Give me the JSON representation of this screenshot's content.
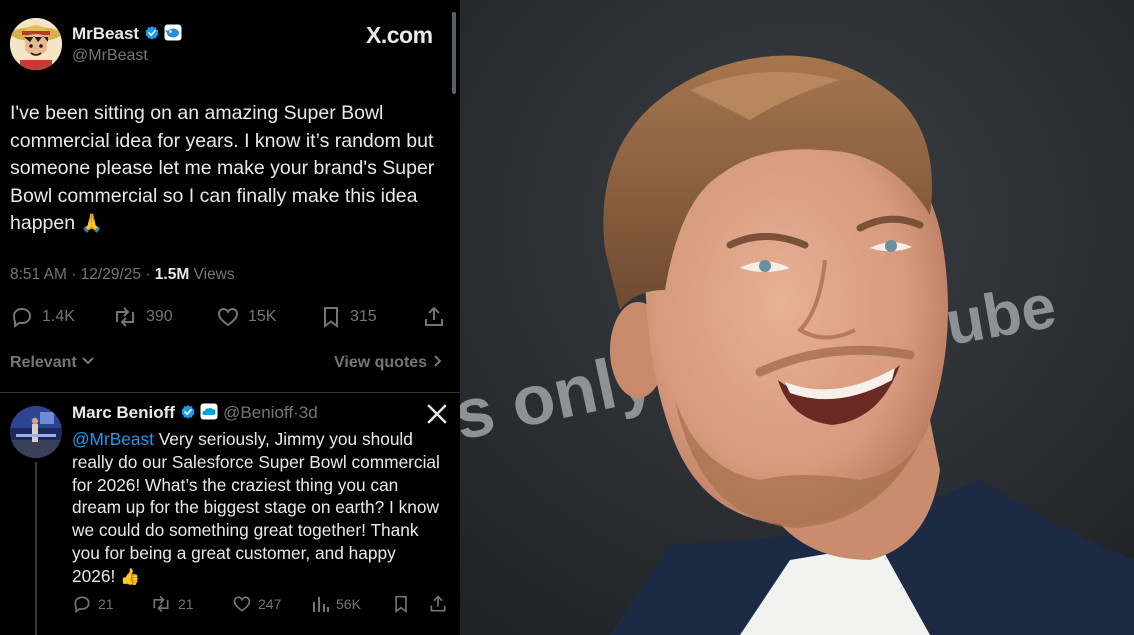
{
  "post": {
    "author_name": "MrBeast",
    "author_handle": "@MrBeast",
    "brand": "X.com",
    "text_lines": [
      "I've been sitting on an amazing Super Bowl",
      "commercial idea for years. I know it’s random but",
      "someone please let me make your brand's Super",
      "Bowl commercial so I can finally make this idea",
      "happen"
    ],
    "emoji": "🙏",
    "time": "8:51 AM",
    "date": "12/29/25",
    "views_count": "1.5M",
    "views_label": "Views",
    "replies": "1.4K",
    "reposts": "390",
    "likes": "15K",
    "bookmarks": "315"
  },
  "controls": {
    "sort_label": "Relevant",
    "view_quotes": "View quotes"
  },
  "reply": {
    "author_name": "Marc Benioff",
    "author_handle": "@Benioff",
    "age": "3d",
    "mention": "@MrBeast",
    "text_lines": [
      " Very seriously, Jimmy you should",
      "really do our Salesforce Super Bowl commercial",
      "for 2026!  What’s the craziest thing you can",
      "dream up for the biggest stage on earth?  I know",
      "we could do something great together! Thank",
      "you for being a great customer, and happy",
      "2026!"
    ],
    "emoji": "👍",
    "replies": "21",
    "reposts": "21",
    "likes": "247",
    "views": "56K"
  },
  "photo": {
    "backdrop_text": "s only",
    "backdrop_text_2": "ube"
  },
  "colors": {
    "accent": "#1d9bf0",
    "muted": "#71767b",
    "backdrop": "#2d3034"
  }
}
